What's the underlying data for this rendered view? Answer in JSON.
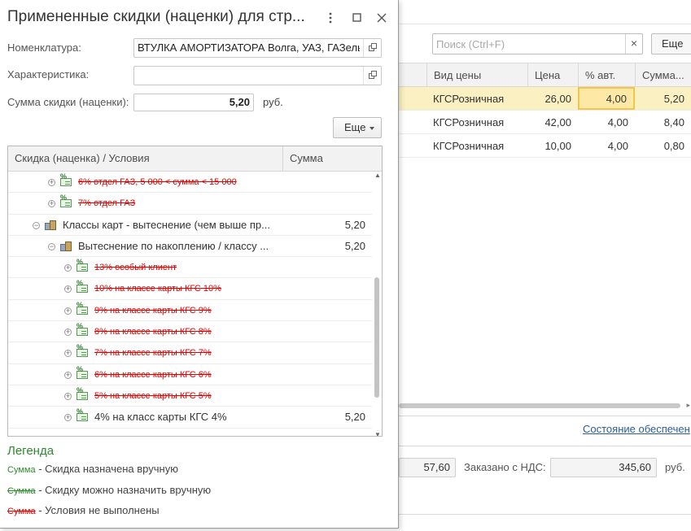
{
  "background": {
    "search": {
      "placeholder": "Поиск (Ctrl+F)",
      "clear_icon": "close-icon"
    },
    "more_label": "Еще",
    "columns": [
      "Вид цены",
      "Цена",
      "% авт.",
      "Сумма..."
    ],
    "rows": [
      {
        "price_type": "КГСРозничная",
        "price": "26,00",
        "auto_pct": "4,00",
        "sum": "5,20"
      },
      {
        "price_type": "КГСРозничная",
        "price": "42,00",
        "auto_pct": "4,00",
        "sum": "8,40"
      },
      {
        "price_type": "КГСРозничная",
        "price": "10,00",
        "auto_pct": "4,00",
        "sum": "0,80"
      }
    ],
    "status_link": "Состояние обеспечен",
    "total_left": "57,60",
    "ordered_vat_label": "Заказано с НДС:",
    "ordered_vat_value": "345,60",
    "currency": "руб."
  },
  "dialog": {
    "title": "Примененные скидки (наценки) для стр...",
    "more_icon": "vertical-dots-icon",
    "maximize_icon": "maximize-icon",
    "close_icon": "close-icon",
    "nomenclature_label": "Номенклатура:",
    "nomenclature_value": "ВТУЛКА АМОРТИЗАТОРА Волга, УАЗ, ГАЗель",
    "characteristic_label": "Характеристика:",
    "characteristic_value": "",
    "discount_sum_label": "Сумма скидки (наценки):",
    "discount_sum_value": "5,20",
    "currency": "руб.",
    "more_label": "Еще",
    "tree": {
      "col_name": "Скидка (наценка) / Условия",
      "col_sum": "Сумма",
      "rows": [
        {
          "level": 2,
          "icon": "discount-icon",
          "expander": "+",
          "text": "6% отдел ГАЗ, 5 000 < сумма < 15 000",
          "sum": "",
          "status": "not-met"
        },
        {
          "level": 2,
          "icon": "discount-icon",
          "expander": "+",
          "text": "7% отдел ГАЗ",
          "sum": "",
          "status": "not-met"
        },
        {
          "level": 1,
          "icon": "group-icon",
          "expander": "−",
          "text": "Классы карт - вытеснение (чем выше пр...",
          "sum": "5,20",
          "status": "applied"
        },
        {
          "level": 2,
          "icon": "group-icon",
          "expander": "−",
          "text": "Вытеснение по накоплению / классу ...",
          "sum": "5,20",
          "status": "applied"
        },
        {
          "level": 3,
          "icon": "discount-icon",
          "expander": "+",
          "text": "13% особый клиент",
          "sum": "",
          "status": "not-met"
        },
        {
          "level": 3,
          "icon": "discount-icon",
          "expander": "+",
          "text": "10% на классе карты КГС 10%",
          "sum": "",
          "status": "not-met"
        },
        {
          "level": 3,
          "icon": "discount-icon",
          "expander": "+",
          "text": "9% на классе карты КГС 9%",
          "sum": "",
          "status": "not-met"
        },
        {
          "level": 3,
          "icon": "discount-icon",
          "expander": "+",
          "text": "8% на классе карты КГС 8%",
          "sum": "",
          "status": "not-met"
        },
        {
          "level": 3,
          "icon": "discount-icon",
          "expander": "+",
          "text": "7% на классе карты КГС 7%",
          "sum": "",
          "status": "not-met"
        },
        {
          "level": 3,
          "icon": "discount-icon",
          "expander": "+",
          "text": "6% на классе карты КГС 6%",
          "sum": "",
          "status": "not-met"
        },
        {
          "level": 3,
          "icon": "discount-icon",
          "expander": "+",
          "text": "5% на классе карты КГС 5%",
          "sum": "",
          "status": "not-met"
        },
        {
          "level": 3,
          "icon": "discount-icon",
          "expander": "+",
          "text": "4% на класс карты КГС 4%",
          "sum": "5,20",
          "status": "applied"
        }
      ]
    },
    "legend": {
      "title": "Легенда",
      "items": [
        {
          "key": "Сумма",
          "style": "manual",
          "desc": "- Скидка назначена вручную"
        },
        {
          "key": "Сумма",
          "style": "canmanual",
          "desc": "- Скидку можно назначить вручную"
        },
        {
          "key": "Сумма",
          "style": "notmet",
          "desc": "- Условия не выполнены"
        }
      ]
    },
    "colors": {
      "legend_green": "#2e8b2e",
      "not_met_red": "#e00000",
      "selected_row": "#fbf0c2"
    }
  }
}
